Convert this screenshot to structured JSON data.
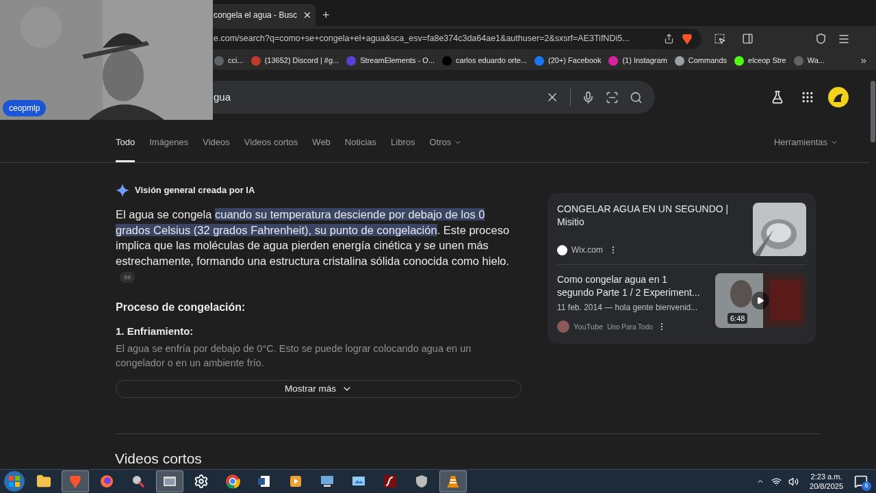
{
  "webcam": {
    "kind": "picture",
    "label": "ceopmlp"
  },
  "browser": {
    "tab_title": "congela el agua - Busc",
    "new_tab": "+",
    "url": "e.com/search?q=como+se+congela+el+agua&sca_esv=fa8e374c3da64ae1&authuser=2&sxsrf=AE3TifNDi5...",
    "bookmarks": [
      {
        "label": "cci...",
        "color": "#5f6368"
      },
      {
        "label": "(13652) Discord | #g...",
        "color": "#c0392b"
      },
      {
        "label": "StreamElements - O...",
        "color": "#5b3fd6"
      },
      {
        "label": "carlos eduardo orte...",
        "color": "#000000"
      },
      {
        "label": "(20+) Facebook",
        "color": "#1877f2"
      },
      {
        "label": "(1) Instagram",
        "color": "#d6249f"
      },
      {
        "label": "Commands",
        "color": "#9aa0a6"
      },
      {
        "label": "elceop Stre",
        "color": "#53fc18"
      },
      {
        "label": "Wa...",
        "color": "#5f6368"
      }
    ],
    "more_bookmarks": "»"
  },
  "search": {
    "value": "gua"
  },
  "filters": [
    {
      "label": "Todo",
      "selected": true,
      "dropdown": false
    },
    {
      "label": "Imágenes",
      "selected": false,
      "dropdown": false
    },
    {
      "label": "Videos",
      "selected": false,
      "dropdown": false
    },
    {
      "label": "Videos cortos",
      "selected": false,
      "dropdown": false
    },
    {
      "label": "Web",
      "selected": false,
      "dropdown": false
    },
    {
      "label": "Noticias",
      "selected": false,
      "dropdown": false
    },
    {
      "label": "Libros",
      "selected": false,
      "dropdown": false
    },
    {
      "label": "Otros",
      "selected": false,
      "dropdown": true
    }
  ],
  "tools": {
    "label": "Herramientas"
  },
  "ai_overview": {
    "heading": "Visión general creada por IA",
    "paragraph": {
      "before": "El agua se congela ",
      "highlight": "cuando su temperatura desciende por debajo de los 0 grados Celsius (32 grados Fahrenheit), su punto de congelación",
      "after": ". Este proceso implica que las moléculas de agua pierden energía cinética y se unen más estrechamente, formando una estructura cristalina sólida conocida como hielo."
    },
    "section_title": "Proceso de congelación:",
    "step_title": "1. Enfriamiento:",
    "step_text": "El agua se enfría por debajo de 0°C. Esto se puede lograr colocando agua en un congelador o en un ambiente frío.",
    "show_more": "Mostrar más"
  },
  "sources": [
    {
      "kind": "article",
      "title": "CONGELAR AGUA EN UN SEGUNDO | Misitio",
      "site": "Wix.com"
    },
    {
      "kind": "video",
      "title": "Como congelar agua en 1 segundo Parte 1 / 2 Experiment...",
      "snippet": "11 feb. 2014 — hola gente bienvenid...",
      "site": "YouTube",
      "channel": "Uno Para Todo",
      "duration": "6:48"
    }
  ],
  "next_section": "Videos cortos",
  "taskbar": {
    "apps": [
      {
        "open": false
      },
      {
        "open": true
      },
      {
        "open": false
      },
      {
        "open": false
      },
      {
        "open": true
      },
      {
        "open": false
      },
      {
        "open": false
      },
      {
        "open": false
      },
      {
        "open": false
      },
      {
        "open": false
      },
      {
        "open": false
      },
      {
        "open": false
      },
      {
        "open": false
      },
      {
        "open": true
      }
    ],
    "time": "2:23 a.m.",
    "date": "20/8/2025",
    "notifications": "6"
  }
}
